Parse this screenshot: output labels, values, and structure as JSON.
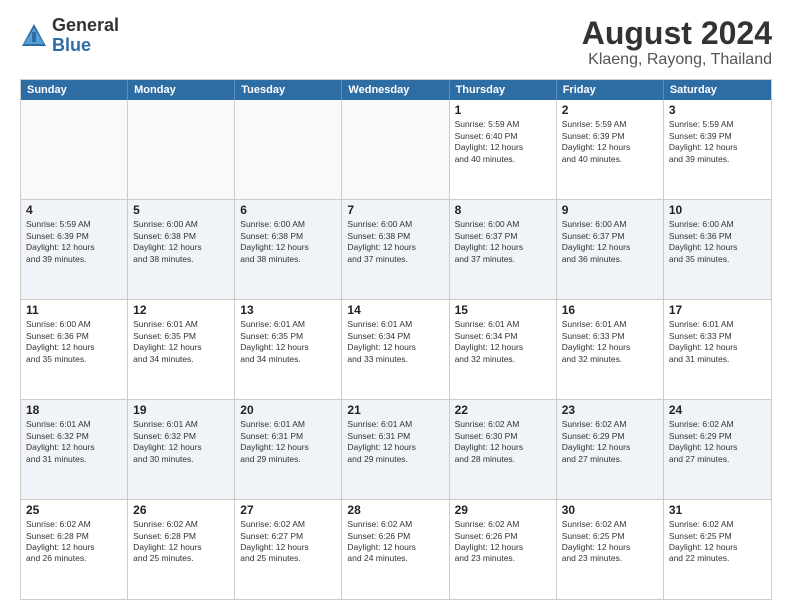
{
  "logo": {
    "general": "General",
    "blue": "Blue"
  },
  "header": {
    "title": "August 2024",
    "subtitle": "Klaeng, Rayong, Thailand"
  },
  "weekdays": [
    "Sunday",
    "Monday",
    "Tuesday",
    "Wednesday",
    "Thursday",
    "Friday",
    "Saturday"
  ],
  "rows": [
    [
      {
        "day": "",
        "empty": true
      },
      {
        "day": "",
        "empty": true
      },
      {
        "day": "",
        "empty": true
      },
      {
        "day": "",
        "empty": true
      },
      {
        "day": "1",
        "text": "Sunrise: 5:59 AM\nSunset: 6:40 PM\nDaylight: 12 hours\nand 40 minutes."
      },
      {
        "day": "2",
        "text": "Sunrise: 5:59 AM\nSunset: 6:39 PM\nDaylight: 12 hours\nand 40 minutes."
      },
      {
        "day": "3",
        "text": "Sunrise: 5:59 AM\nSunset: 6:39 PM\nDaylight: 12 hours\nand 39 minutes."
      }
    ],
    [
      {
        "day": "4",
        "text": "Sunrise: 5:59 AM\nSunset: 6:39 PM\nDaylight: 12 hours\nand 39 minutes."
      },
      {
        "day": "5",
        "text": "Sunrise: 6:00 AM\nSunset: 6:38 PM\nDaylight: 12 hours\nand 38 minutes."
      },
      {
        "day": "6",
        "text": "Sunrise: 6:00 AM\nSunset: 6:38 PM\nDaylight: 12 hours\nand 38 minutes."
      },
      {
        "day": "7",
        "text": "Sunrise: 6:00 AM\nSunset: 6:38 PM\nDaylight: 12 hours\nand 37 minutes."
      },
      {
        "day": "8",
        "text": "Sunrise: 6:00 AM\nSunset: 6:37 PM\nDaylight: 12 hours\nand 37 minutes."
      },
      {
        "day": "9",
        "text": "Sunrise: 6:00 AM\nSunset: 6:37 PM\nDaylight: 12 hours\nand 36 minutes."
      },
      {
        "day": "10",
        "text": "Sunrise: 6:00 AM\nSunset: 6:36 PM\nDaylight: 12 hours\nand 35 minutes."
      }
    ],
    [
      {
        "day": "11",
        "text": "Sunrise: 6:00 AM\nSunset: 6:36 PM\nDaylight: 12 hours\nand 35 minutes."
      },
      {
        "day": "12",
        "text": "Sunrise: 6:01 AM\nSunset: 6:35 PM\nDaylight: 12 hours\nand 34 minutes."
      },
      {
        "day": "13",
        "text": "Sunrise: 6:01 AM\nSunset: 6:35 PM\nDaylight: 12 hours\nand 34 minutes."
      },
      {
        "day": "14",
        "text": "Sunrise: 6:01 AM\nSunset: 6:34 PM\nDaylight: 12 hours\nand 33 minutes."
      },
      {
        "day": "15",
        "text": "Sunrise: 6:01 AM\nSunset: 6:34 PM\nDaylight: 12 hours\nand 32 minutes."
      },
      {
        "day": "16",
        "text": "Sunrise: 6:01 AM\nSunset: 6:33 PM\nDaylight: 12 hours\nand 32 minutes."
      },
      {
        "day": "17",
        "text": "Sunrise: 6:01 AM\nSunset: 6:33 PM\nDaylight: 12 hours\nand 31 minutes."
      }
    ],
    [
      {
        "day": "18",
        "text": "Sunrise: 6:01 AM\nSunset: 6:32 PM\nDaylight: 12 hours\nand 31 minutes."
      },
      {
        "day": "19",
        "text": "Sunrise: 6:01 AM\nSunset: 6:32 PM\nDaylight: 12 hours\nand 30 minutes."
      },
      {
        "day": "20",
        "text": "Sunrise: 6:01 AM\nSunset: 6:31 PM\nDaylight: 12 hours\nand 29 minutes."
      },
      {
        "day": "21",
        "text": "Sunrise: 6:01 AM\nSunset: 6:31 PM\nDaylight: 12 hours\nand 29 minutes."
      },
      {
        "day": "22",
        "text": "Sunrise: 6:02 AM\nSunset: 6:30 PM\nDaylight: 12 hours\nand 28 minutes."
      },
      {
        "day": "23",
        "text": "Sunrise: 6:02 AM\nSunset: 6:29 PM\nDaylight: 12 hours\nand 27 minutes."
      },
      {
        "day": "24",
        "text": "Sunrise: 6:02 AM\nSunset: 6:29 PM\nDaylight: 12 hours\nand 27 minutes."
      }
    ],
    [
      {
        "day": "25",
        "text": "Sunrise: 6:02 AM\nSunset: 6:28 PM\nDaylight: 12 hours\nand 26 minutes."
      },
      {
        "day": "26",
        "text": "Sunrise: 6:02 AM\nSunset: 6:28 PM\nDaylight: 12 hours\nand 25 minutes."
      },
      {
        "day": "27",
        "text": "Sunrise: 6:02 AM\nSunset: 6:27 PM\nDaylight: 12 hours\nand 25 minutes."
      },
      {
        "day": "28",
        "text": "Sunrise: 6:02 AM\nSunset: 6:26 PM\nDaylight: 12 hours\nand 24 minutes."
      },
      {
        "day": "29",
        "text": "Sunrise: 6:02 AM\nSunset: 6:26 PM\nDaylight: 12 hours\nand 23 minutes."
      },
      {
        "day": "30",
        "text": "Sunrise: 6:02 AM\nSunset: 6:25 PM\nDaylight: 12 hours\nand 23 minutes."
      },
      {
        "day": "31",
        "text": "Sunrise: 6:02 AM\nSunset: 6:25 PM\nDaylight: 12 hours\nand 22 minutes."
      }
    ]
  ]
}
